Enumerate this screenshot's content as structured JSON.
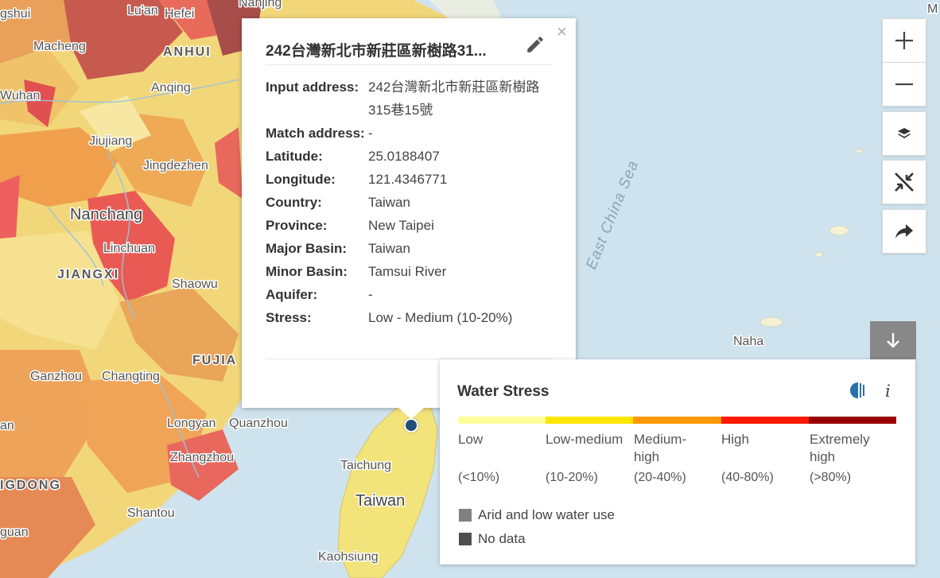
{
  "map": {
    "labels": {
      "hefei": "Hefei",
      "luan": "Lu'an",
      "nanjing": "Nanjing",
      "anhui": "ANHUI",
      "macheng": "Macheng",
      "anqing": "Anqing",
      "wuhan": "Wuhan",
      "jiujiang": "Jiujiang",
      "jingdezhen": "Jingdezhen",
      "nanchang": "Nanchang",
      "linchuan": "Linchuan",
      "jiangxi": "JIANGXI",
      "shaowu": "Shaowu",
      "fujian": "FUJIA",
      "ganzhou": "Ganzhou",
      "changting": "Changting",
      "longyan": "Longyan",
      "quanzhou": "Quanzhou",
      "zhangzhou": "Zhangzhou",
      "guangdong": "IGDONG",
      "shantou": "Shantou",
      "taichung": "Taichung",
      "taiwan": "Taiwan",
      "kaohsiung": "Kaohsiung",
      "naha": "Naha",
      "east_china_sea": "East China Sea",
      "left_top": "gshui",
      "left_an": "an",
      "left_guan": "guan",
      "top_right": "M"
    }
  },
  "popup": {
    "title": "242台灣新北市新莊區新樹路31...",
    "fields": [
      {
        "label": "Input address:",
        "value": "242台灣新北市新莊區新樹路315巷15號"
      },
      {
        "label": "Match address:",
        "value": "-"
      },
      {
        "label": "Latitude:",
        "value": "25.0188407"
      },
      {
        "label": "Longitude:",
        "value": "121.4346771"
      },
      {
        "label": "Country:",
        "value": "Taiwan"
      },
      {
        "label": "Province:",
        "value": "New Taipei"
      },
      {
        "label": "Major Basin:",
        "value": "Taiwan"
      },
      {
        "label": "Minor Basin:",
        "value": "Tamsui River"
      },
      {
        "label": "Aquifer:",
        "value": "-"
      },
      {
        "label": "Stress:",
        "value": "Low - Medium (10-20%)"
      }
    ],
    "close": "×"
  },
  "controls": {
    "zoom_in": "+",
    "zoom_out": "−"
  },
  "legend": {
    "title": "Water Stress",
    "info": "i",
    "categories": [
      {
        "name": "Low",
        "range": "(<10%)",
        "color": "#ffff99"
      },
      {
        "name": "Low-medium",
        "range": "(10-20%)",
        "color": "#ffe600"
      },
      {
        "name": "Medium-high",
        "range": "(20-40%)",
        "color": "#ff9900"
      },
      {
        "name": "High",
        "range": "(40-80%)",
        "color": "#ff1900"
      },
      {
        "name": "Extremely high",
        "range": "(>80%)",
        "color": "#990000"
      }
    ],
    "arid": {
      "label": "Arid and low water use",
      "color": "#808080"
    },
    "nodata": {
      "label": "No data",
      "color": "#4e4e4e"
    }
  }
}
